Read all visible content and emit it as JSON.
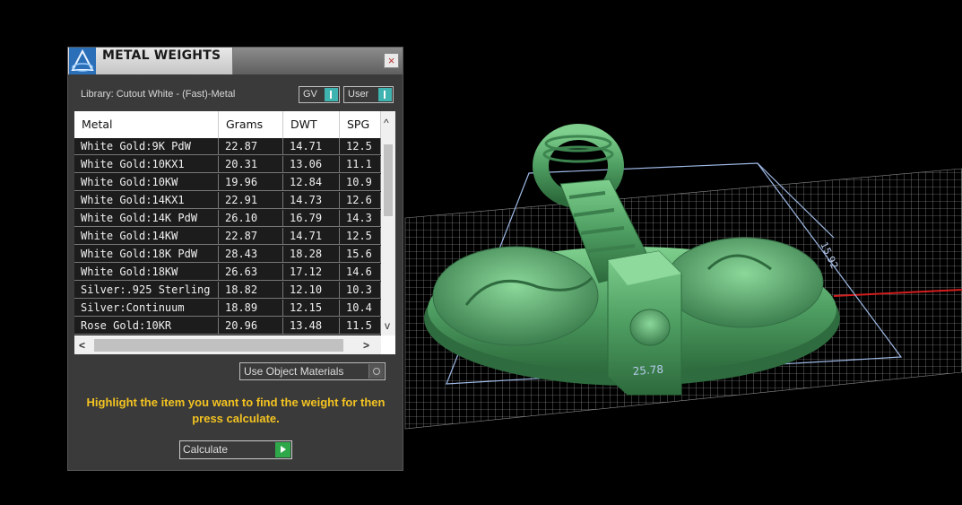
{
  "panel": {
    "title": "METAL WEIGHTS",
    "close_glyph": "×",
    "library_label": "Library: Cutout White - (Fast)-Metal",
    "toggle_gv": "GV",
    "toggle_user": "User",
    "use_object_materials": "Use Object Materials",
    "hint": "Highlight the item you want to find the weight for then press calculate.",
    "calculate": "Calculate",
    "scroll_left": "<",
    "scroll_right": ">",
    "scroll_up": "^",
    "scroll_down": "v"
  },
  "table": {
    "columns": [
      "Metal",
      "Grams",
      "DWT",
      "SPG"
    ],
    "rows": [
      [
        "White Gold:9K PdW",
        "22.87",
        "14.71",
        "12.5"
      ],
      [
        "White Gold:10KX1",
        "20.31",
        "13.06",
        "11.1"
      ],
      [
        "White Gold:10KW",
        "19.96",
        "12.84",
        "10.9"
      ],
      [
        "White Gold:14KX1",
        "22.91",
        "14.73",
        "12.6"
      ],
      [
        "White Gold:14K PdW",
        "26.10",
        "16.79",
        "14.3"
      ],
      [
        "White Gold:14KW",
        "22.87",
        "14.71",
        "12.5"
      ],
      [
        "White Gold:18K PdW",
        "28.43",
        "18.28",
        "15.6"
      ],
      [
        "White Gold:18KW",
        "26.63",
        "17.12",
        "14.6"
      ],
      [
        "Silver:.925 Sterling",
        "18.82",
        "12.10",
        "10.3"
      ],
      [
        "Silver:Continuum",
        "18.89",
        "12.15",
        "10.4"
      ],
      [
        "Rose Gold:10KR",
        "20.96",
        "13.48",
        "11.5"
      ]
    ]
  },
  "viewport": {
    "dimension_width": "25.78",
    "dimension_height": "15.92",
    "model_color": "#4e9e62",
    "grid_color": "#ffffff",
    "axis_color": "#d21e1e"
  },
  "colors": {
    "hint_text": "#f3c321",
    "toggle_accent": "#3fb3b0",
    "calculate_accent": "#2fa84a"
  },
  "icons": {
    "logo": "matrix-logo-icon",
    "close": "close-icon",
    "calculate": "play-arrow-icon"
  }
}
